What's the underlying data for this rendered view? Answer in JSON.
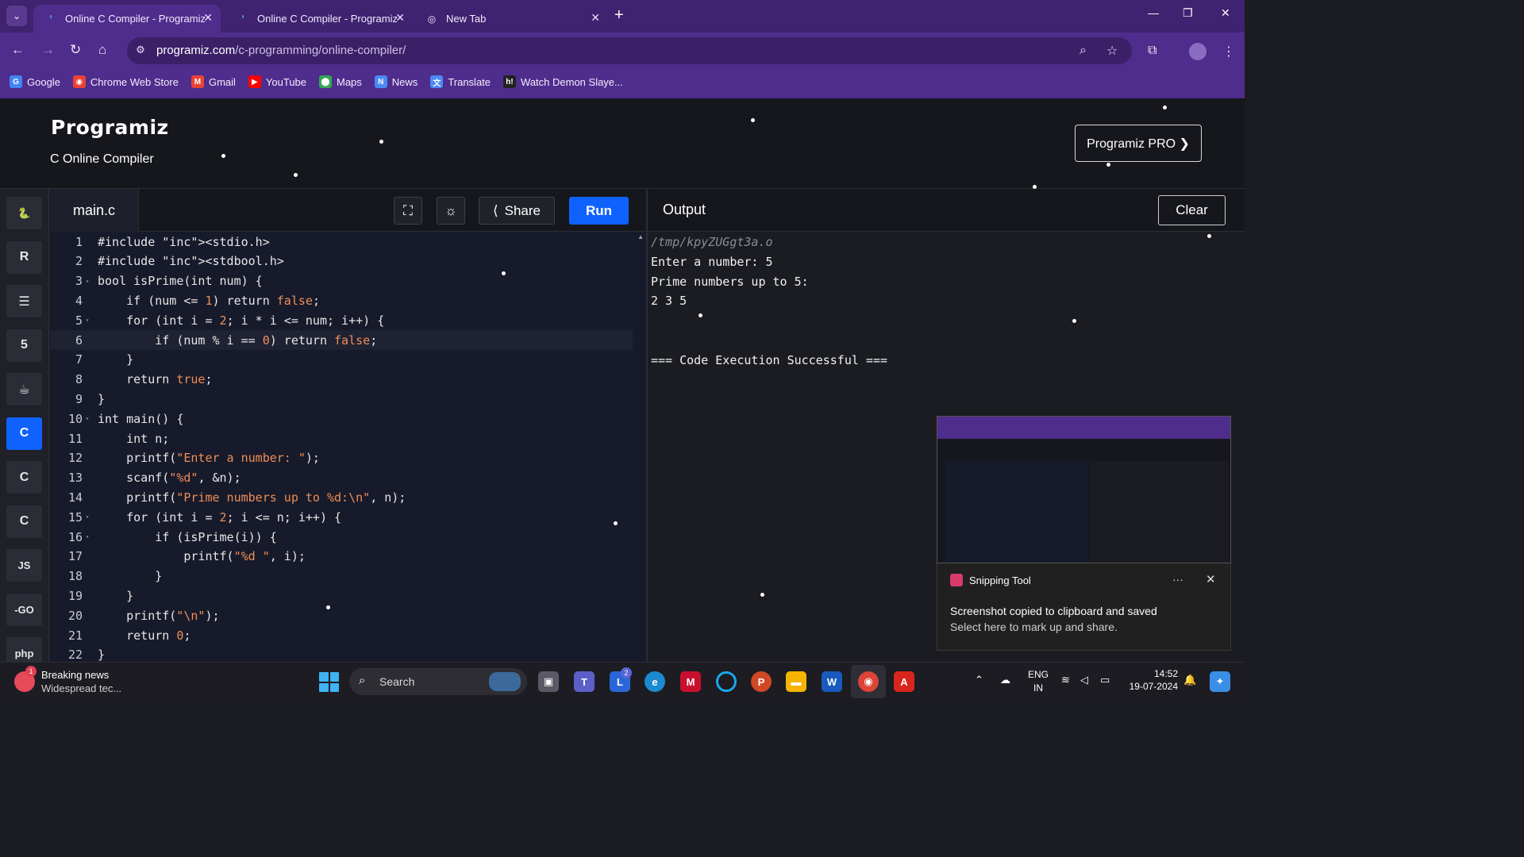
{
  "browser": {
    "tabs": [
      {
        "title": "Online C Compiler - Programiz",
        "active": true
      },
      {
        "title": "Online C Compiler - Programiz",
        "active": false
      },
      {
        "title": "New Tab",
        "active": false
      }
    ],
    "url_host": "programiz.com",
    "url_path": "/c-programming/online-compiler/",
    "bookmarks": [
      {
        "label": "Google",
        "color": "#4285f4",
        "icon": "G"
      },
      {
        "label": "Chrome Web Store",
        "color": "#e94235",
        "icon": "◉"
      },
      {
        "label": "Gmail",
        "color": "#ea4335",
        "icon": "M"
      },
      {
        "label": "YouTube",
        "color": "#ff0000",
        "icon": "▶"
      },
      {
        "label": "Maps",
        "color": "#34a853",
        "icon": "⬤"
      },
      {
        "label": "News",
        "color": "#4a8af4",
        "icon": "N"
      },
      {
        "label": "Translate",
        "color": "#4a8af4",
        "icon": "文"
      },
      {
        "label": "Watch Demon Slaye...",
        "color": "#222222",
        "icon": "h!"
      }
    ]
  },
  "header": {
    "logo": "Programiz",
    "subtitle": "C Online Compiler",
    "pro_button": "Programiz PRO ❯"
  },
  "languages": [
    {
      "name": "python-icon",
      "glyph": "🐍",
      "active": false
    },
    {
      "name": "r-icon",
      "glyph": "R",
      "active": false
    },
    {
      "name": "sql-icon",
      "glyph": "☰",
      "active": false
    },
    {
      "name": "html-icon",
      "glyph": "5",
      "active": false
    },
    {
      "name": "java-icon",
      "glyph": "☕",
      "active": false
    },
    {
      "name": "c-icon",
      "glyph": "C",
      "active": true
    },
    {
      "name": "cpp-icon",
      "glyph": "C",
      "active": false
    },
    {
      "name": "csharp-icon",
      "glyph": "C",
      "active": false
    },
    {
      "name": "js-icon",
      "glyph": "JS",
      "active": false
    },
    {
      "name": "go-icon",
      "glyph": "-GO",
      "active": false
    },
    {
      "name": "php-icon",
      "glyph": "php",
      "active": false
    }
  ],
  "editor": {
    "filename": "main.c",
    "share_label": "Share",
    "run_label": "Run",
    "current_line": 6,
    "lines": [
      "#include <stdio.h>",
      "#include <stdbool.h>",
      "bool isPrime(int num) {",
      "    if (num <= 1) return false;",
      "    for (int i = 2; i * i <= num; i++) {",
      "        if (num % i == 0) return false;",
      "    }",
      "    return true;",
      "}",
      "int main() {",
      "    int n;",
      "    printf(\"Enter a number: \");",
      "    scanf(\"%d\", &n);",
      "    printf(\"Prime numbers up to %d:\\n\", n);",
      "    for (int i = 2; i <= n; i++) {",
      "        if (isPrime(i)) {",
      "            printf(\"%d \", i);",
      "        }",
      "    }",
      "    printf(\"\\n\");",
      "    return 0;",
      "}"
    ],
    "fold_lines": [
      3,
      5,
      10,
      15,
      16
    ]
  },
  "output": {
    "title": "Output",
    "clear_label": "Clear",
    "lines": [
      "/tmp/kpyZUGgt3a.o",
      "Enter a number: 5",
      "Prime numbers up to 5:",
      "2 3 5",
      "",
      "",
      "=== Code Execution Successful ==="
    ]
  },
  "toast": {
    "app": "Snipping Tool",
    "more": "···",
    "message": "Screenshot copied to clipboard and saved",
    "sub": "Select here to mark up and share."
  },
  "taskbar": {
    "news_title": "Breaking news",
    "news_sub": "Widespread tec...",
    "news_badge": "1",
    "search_label": "Search",
    "teams_badge": "2",
    "lang_line1": "ENG",
    "lang_line2": "IN",
    "time": "14:52",
    "date": "19-07-2024"
  }
}
